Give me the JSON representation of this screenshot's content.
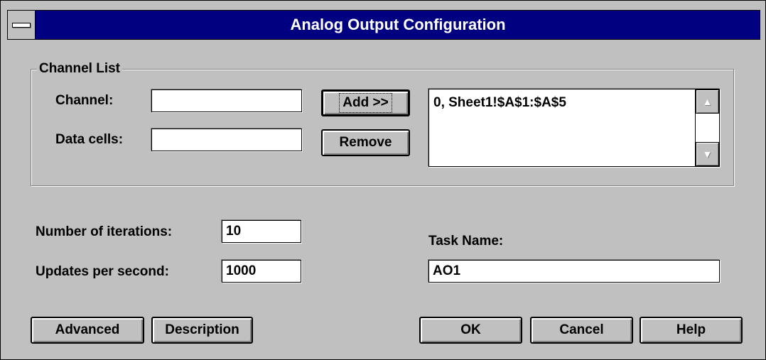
{
  "window": {
    "title": "Analog Output Configuration"
  },
  "channel_list": {
    "group_label": "Channel List",
    "channel_label": "Channel:",
    "channel_value": "",
    "data_cells_label": "Data cells:",
    "data_cells_value": "",
    "add_button": "Add >>",
    "remove_button": "Remove",
    "list_items": [
      "0, Sheet1!$A$1:$A$5"
    ]
  },
  "settings": {
    "iterations_label": "Number of iterations:",
    "iterations_value": "10",
    "updates_label": "Updates per second:",
    "updates_value": "1000",
    "task_name_label": "Task Name:",
    "task_name_value": "AO1"
  },
  "buttons": {
    "advanced": "Advanced",
    "description": "Description",
    "ok": "OK",
    "cancel": "Cancel",
    "help": "Help"
  },
  "colors": {
    "title_bar": "#000080",
    "dialog_face": "#c0c0c0"
  },
  "icons": {
    "system_menu": "system-menu-icon",
    "scroll_up": "scroll-up-arrow-icon",
    "scroll_down": "scroll-down-arrow-icon"
  }
}
